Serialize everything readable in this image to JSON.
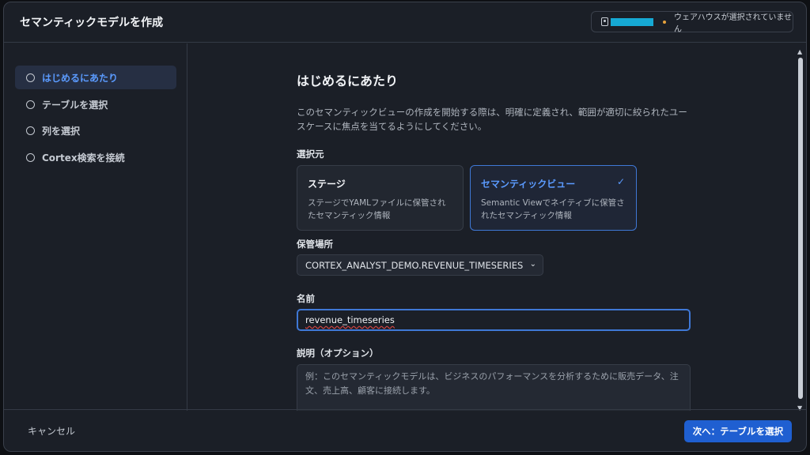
{
  "modal": {
    "title": "セマンティックモデルを作成",
    "context": {
      "user_icon": "person-badge-icon",
      "user_name": "",
      "warehouse_status": "ウェアハウスが選択されていません",
      "status_color": "#e6a23c"
    }
  },
  "sidebar": {
    "steps": [
      {
        "label": "はじめるにあたり",
        "active": true
      },
      {
        "label": "テーブルを選択"
      },
      {
        "label": "列を選択"
      },
      {
        "label": "Cortex検索を接続"
      }
    ]
  },
  "main": {
    "heading": "はじめるにあたり",
    "intro": "このセマンティックビューの作成を開始する際は、明確に定義され、範囲が適切に絞られたユースケースに焦点を当てるようにしてください。",
    "source_label": "選択元",
    "sources": [
      {
        "title": "ステージ",
        "desc": "ステージでYAMLファイルに保管されたセマンティック情報"
      },
      {
        "title": "セマンティックビュー",
        "desc": "Semantic Viewでネイティブに保管されたセマンティック情報",
        "selected": true
      }
    ],
    "location_label": "保管場所",
    "location_value": "CORTEX_ANALYST_DEMO.REVENUE_TIMESERIES",
    "name_label": "名前",
    "name_value": "revenue_timeseries",
    "desc_label": "説明（オプション）",
    "desc_placeholder": "例：このセマンティックモデルは、ビジネスのパフォーマンスを分析するために販売データ、注文、売上高、顧客に接続します。"
  },
  "footer": {
    "cancel": "キャンセル",
    "next": "次へ：テーブルを選択"
  },
  "colors": {
    "accent": "#1f5fd1",
    "accent_text": "#5b9bff",
    "background": "#1b1f27"
  }
}
